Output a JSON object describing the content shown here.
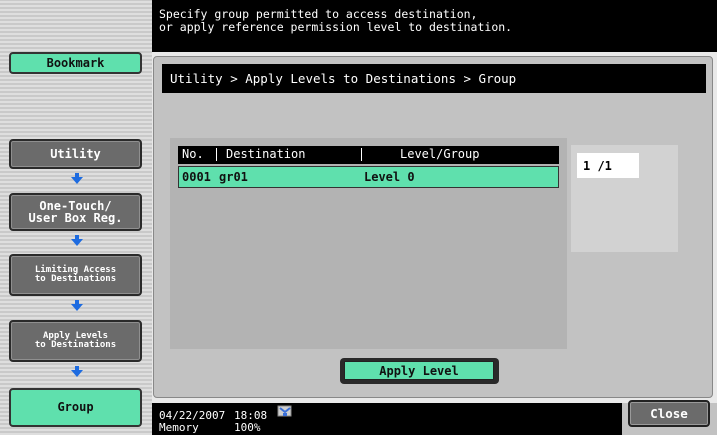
{
  "left_nav": {
    "bookmark": "Bookmark",
    "utility": "Utility",
    "one_touch": "One-Touch/\nUser Box Reg.",
    "limiting": "Limiting Access\nto Destinations",
    "apply_levels": "Apply Levels\nto Destinations",
    "group": "Group"
  },
  "message": "Specify group permitted to access destination,\nor apply reference permission level to destination.",
  "breadcrumb": "Utility > Apply Levels to Destinations > Group",
  "table": {
    "headers": {
      "no": "No.",
      "destination": "Destination",
      "level_group": "Level/Group"
    },
    "rows": [
      {
        "no": "0001",
        "destination": "gr01",
        "level_group": "Level 0"
      }
    ]
  },
  "page_indicator": "1  /1",
  "apply_level_button": "Apply Level",
  "status": {
    "date": "04/22/2007",
    "time": "18:08",
    "memory_label": "Memory",
    "memory_value": "100%"
  },
  "close_button": "Close",
  "colors": {
    "accent_green": "#5fe0ad",
    "arrow_blue": "#1d6be0"
  }
}
